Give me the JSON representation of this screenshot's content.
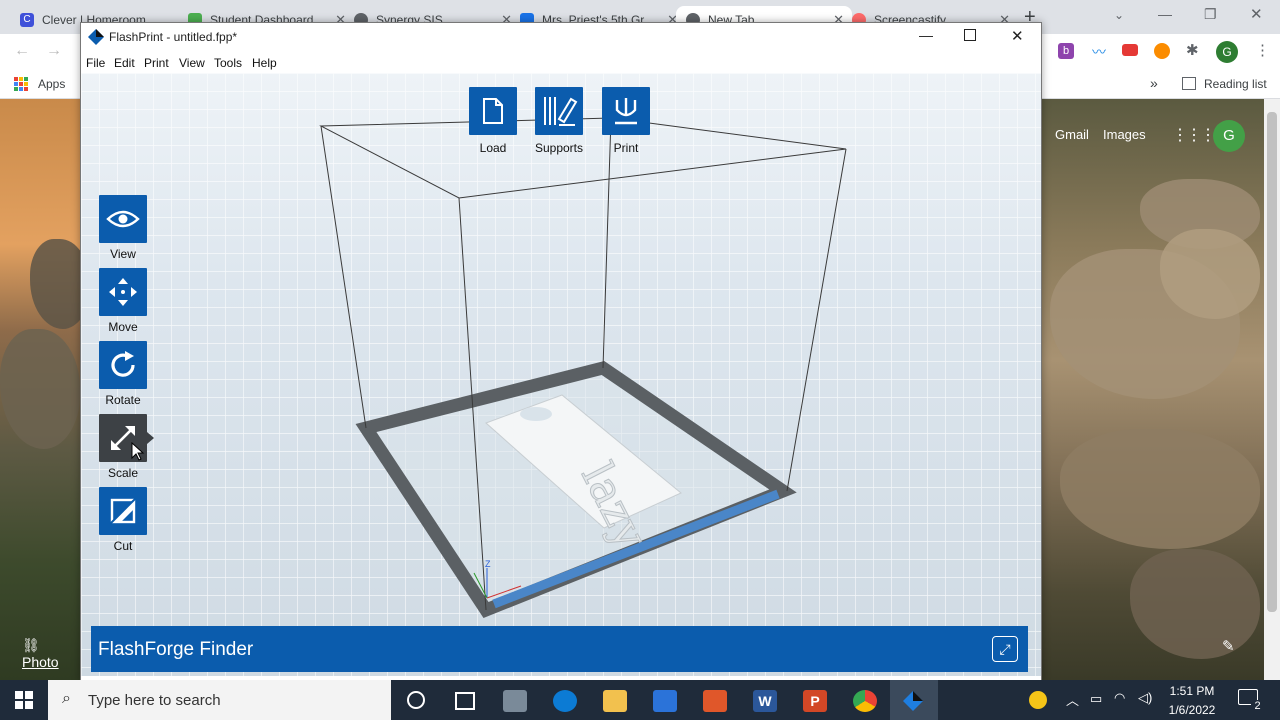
{
  "browser": {
    "tabs": [
      {
        "label": "Clever | Homeroom",
        "icon": "clever-icon",
        "color": "#3f51d9"
      },
      {
        "label": "Student Dashboard",
        "icon": "leaf-icon",
        "color": "#4caf50"
      },
      {
        "label": "Synergy SIS",
        "icon": "globe-icon",
        "color": "#5f6368"
      },
      {
        "label": "Mrs. Priest's 5th Gr",
        "icon": "classroom-icon",
        "color": "#1a73e8"
      },
      {
        "label": "New Tab",
        "icon": "chrome-icon",
        "color": "#5f6368"
      },
      {
        "label": "Screencastify",
        "icon": "screencastify-icon",
        "color": "#ff6b6b"
      }
    ],
    "new_tab": "+",
    "bookmarks_apps": "Apps",
    "bookmarks_more": "»",
    "reading_list": "Reading list",
    "ntp_gmail": "Gmail",
    "ntp_images": "Images",
    "avatar_letter": "G",
    "photo_credit": "Photo"
  },
  "app": {
    "title": "FlashPrint - untitled.fpp*",
    "menu": [
      "File",
      "Edit",
      "Print",
      "View",
      "Tools",
      "Help"
    ],
    "top_tools": [
      {
        "label": "Load",
        "icon": "load-file-icon"
      },
      {
        "label": "Supports",
        "icon": "supports-icon"
      },
      {
        "label": "Print",
        "icon": "print-icon"
      }
    ],
    "side_tools": [
      {
        "label": "View",
        "icon": "eye-icon"
      },
      {
        "label": "Move",
        "icon": "move-arrows-icon"
      },
      {
        "label": "Rotate",
        "icon": "rotate-icon"
      },
      {
        "label": "Scale",
        "icon": "scale-icon",
        "active": true
      },
      {
        "label": "Cut",
        "icon": "cut-icon"
      }
    ],
    "model_text": "lazy",
    "axis_z": "Z",
    "printer_name": "FlashForge Finder",
    "accent": "#0b5cad"
  },
  "taskbar": {
    "search_placeholder": "Type here to search",
    "time": "1:51 PM",
    "date": "1/6/2022",
    "notification_count": "2"
  }
}
